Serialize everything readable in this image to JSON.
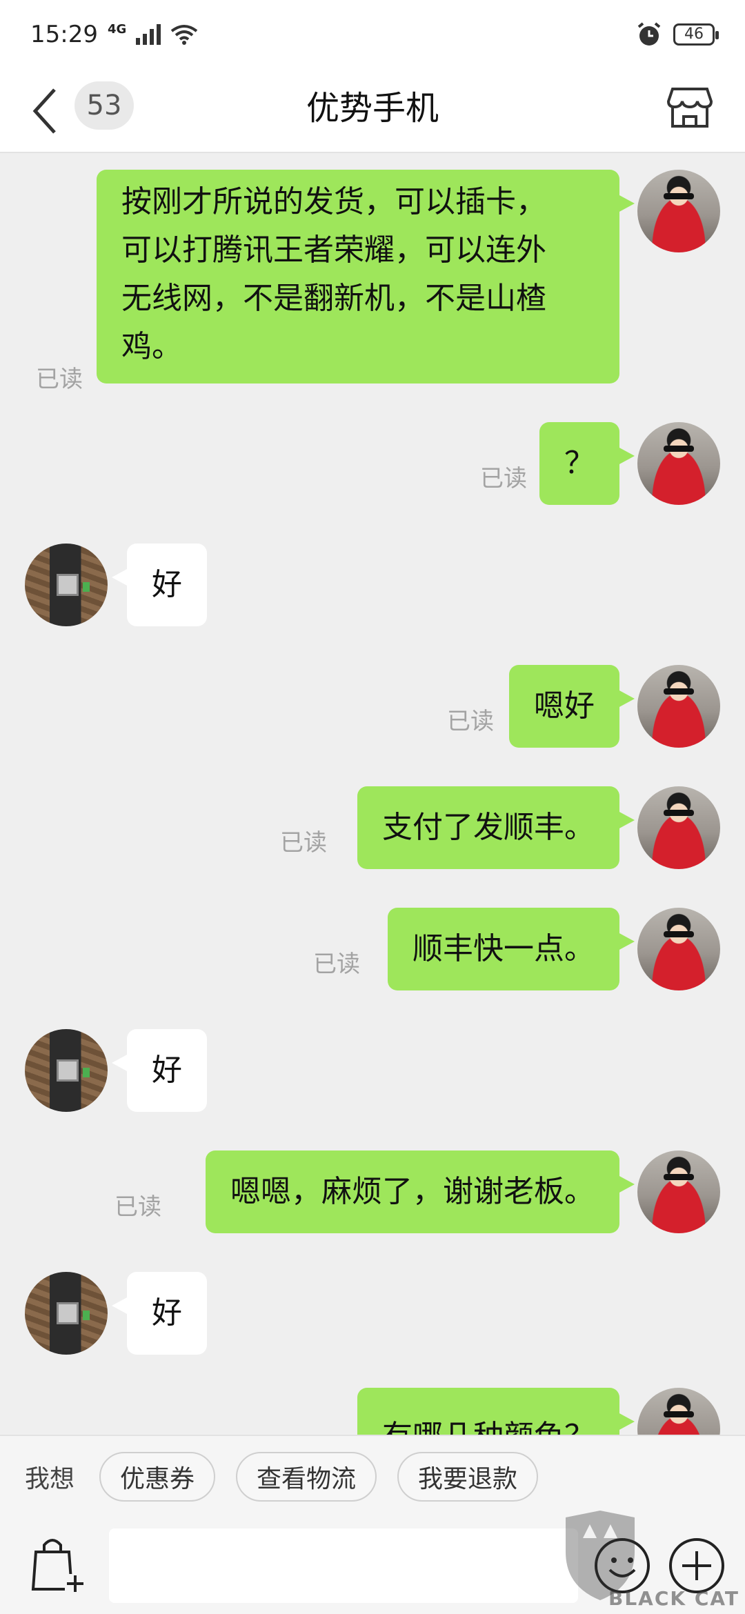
{
  "status_bar": {
    "time": "15:29",
    "network": "4G",
    "battery": "46"
  },
  "header": {
    "unread_count": "53",
    "title": "优势手机"
  },
  "read_label": "已读",
  "messages": [
    {
      "sender": "me",
      "text": "按刚才所说的发货，可以插卡，\n可以打腾讯王者荣耀，可以连外\n无线网，不是翻新机，不是山楂\n鸡。",
      "read": true
    },
    {
      "sender": "me",
      "text": "？",
      "read": true
    },
    {
      "sender": "shop",
      "text": "好"
    },
    {
      "sender": "me",
      "text": "嗯好",
      "read": true
    },
    {
      "sender": "me",
      "text": "支付了发顺丰。",
      "read": true
    },
    {
      "sender": "me",
      "text": "顺丰快一点。",
      "read": true
    },
    {
      "sender": "shop",
      "text": "好"
    },
    {
      "sender": "me",
      "text": "嗯嗯，麻烦了，谢谢老板。",
      "read": true
    },
    {
      "sender": "shop",
      "text": "好"
    },
    {
      "sender": "me",
      "text": "有哪几种颜色？",
      "read": false
    }
  ],
  "quick_actions": {
    "label": "我想",
    "chips": [
      "优惠券",
      "查看物流",
      "我要退款"
    ]
  },
  "input": {
    "placeholder": ""
  },
  "watermark": {
    "text": "BLACK CAT"
  },
  "colors": {
    "my_bubble": "#9ee65b",
    "shop_bubble": "#ffffff",
    "background": "#efefef"
  }
}
